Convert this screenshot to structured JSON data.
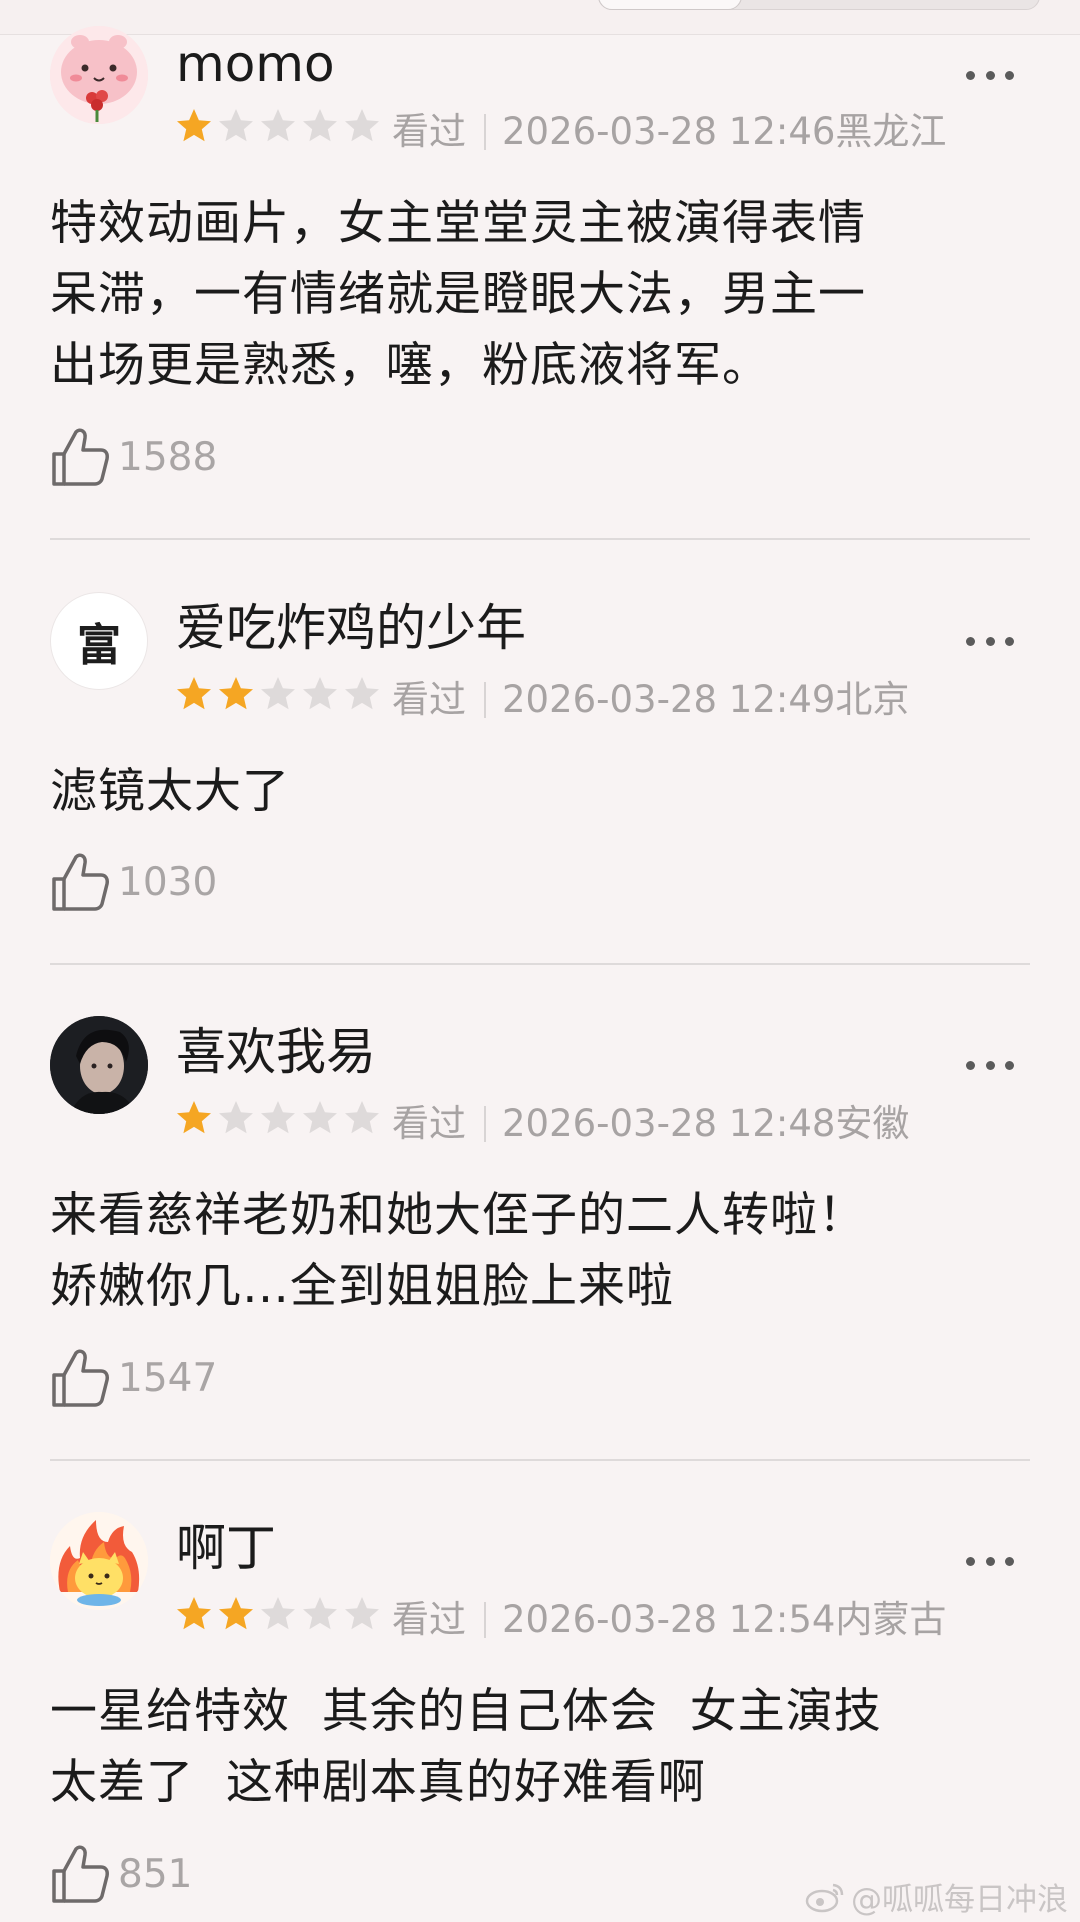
{
  "meta_label": "看过",
  "reviews": [
    {
      "username": "momo",
      "rating": 1,
      "datetime": "2026-03-28 12:46",
      "location": "黑龙江",
      "text": "特效动画片，女主堂堂灵主被演得表情\n呆滞，一有情绪就是瞪眼大法，男主一\n出场更是熟悉，噻，粉底液将军。",
      "likes": "1588",
      "avatar": "pink-cartoon-avatar"
    },
    {
      "username": "爱吃炸鸡的少年",
      "rating": 2,
      "datetime": "2026-03-28 12:49",
      "location": "北京",
      "text": "滤镜太大了",
      "likes": "1030",
      "avatar_text": "富"
    },
    {
      "username": "喜欢我易",
      "rating": 1,
      "datetime": "2026-03-28 12:48",
      "location": "安徽",
      "text": "来看慈祥老奶和她大侄子的二人转啦！\n娇嫩你几…全到姐姐脸上来啦",
      "likes": "1547",
      "avatar": "dark-photo-avatar"
    },
    {
      "username": "啊丁",
      "rating": 2,
      "datetime": "2026-03-28 12:54",
      "location": "内蒙古",
      "text": "一星给特效  其余的自己体会  女主演技\n太差了  这种剧本真的好难看啊",
      "likes": "851",
      "avatar": "flame-cat-avatar"
    }
  ],
  "colors": {
    "star_on": "#f5a623",
    "star_off": "#dedada",
    "background": "#f8f3f3"
  },
  "watermark": "@呱呱每日冲浪"
}
